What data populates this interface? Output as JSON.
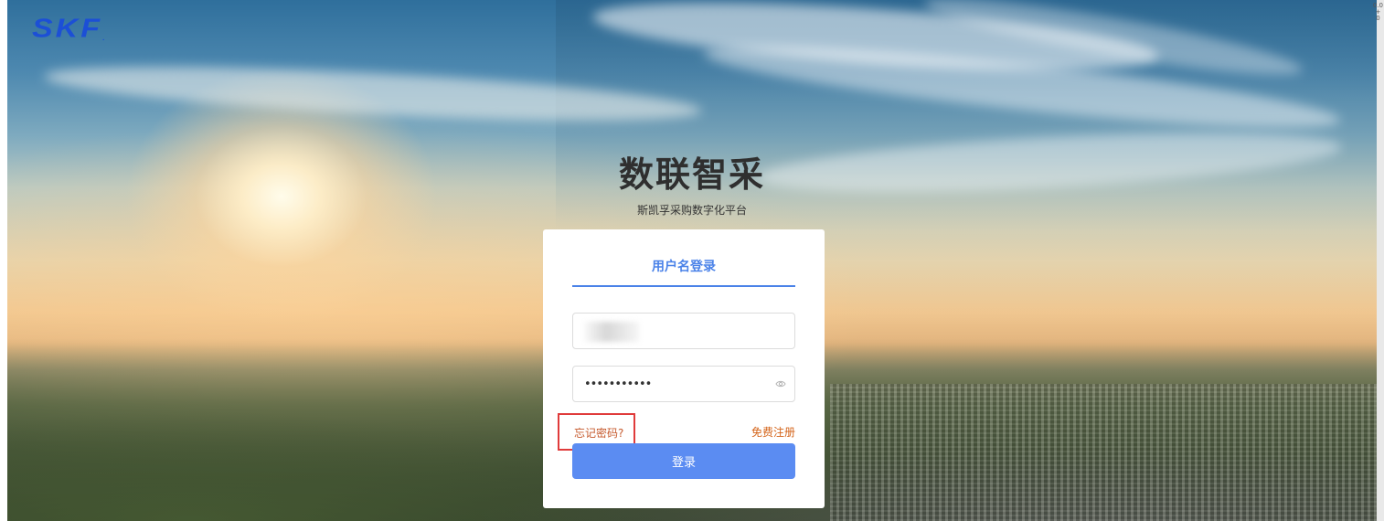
{
  "brand": {
    "logo_text": "SKF",
    "logo_mark": "."
  },
  "header": {
    "title": "数联智采",
    "subtitle": "斯凯孚采购数字化平台"
  },
  "login": {
    "tab_label": "用户名登录",
    "username_value": "",
    "password_value": "•••••••••••",
    "forgot_password": "忘记密码?",
    "register": "免费注册",
    "submit": "登录"
  },
  "scroll": {
    "indicator_top": "0.0",
    "indicator_bottom": "+ 0"
  },
  "colors": {
    "accent": "#4a82e8",
    "button": "#5b8cf2",
    "logo": "#1c4fd6",
    "link": "#d4641a",
    "highlight_box": "#e03b3b"
  },
  "icons": {
    "password_toggle": "eye-icon"
  }
}
